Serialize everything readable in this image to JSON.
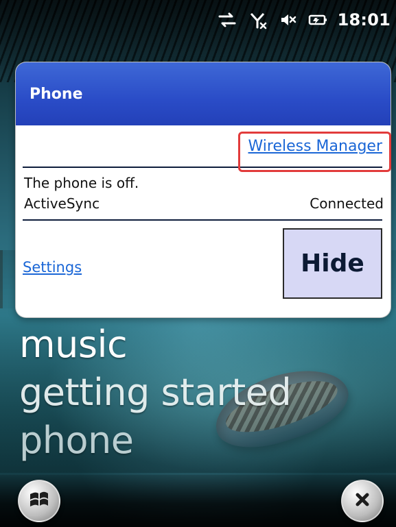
{
  "statusbar": {
    "time": "18:01",
    "icons": [
      "sync-arrows-icon",
      "no-signal-icon",
      "speaker-muted-icon",
      "battery-charging-icon"
    ]
  },
  "dialog": {
    "title": "Phone",
    "wireless_manager_link": "Wireless Manager",
    "phone_status": "The phone is off.",
    "activesync_label": "ActiveSync",
    "activesync_status": "Connected",
    "settings_link": "Settings",
    "hide_button": "Hide"
  },
  "home_menu": {
    "items": [
      "music",
      "getting started",
      "phone"
    ]
  },
  "softkeys": {
    "start_icon": "windows-start-icon",
    "close_icon": "close-icon"
  },
  "colors": {
    "header_blue": "#2a4cc7",
    "link_blue": "#1a66d6",
    "highlight_red": "#e23b3b"
  }
}
